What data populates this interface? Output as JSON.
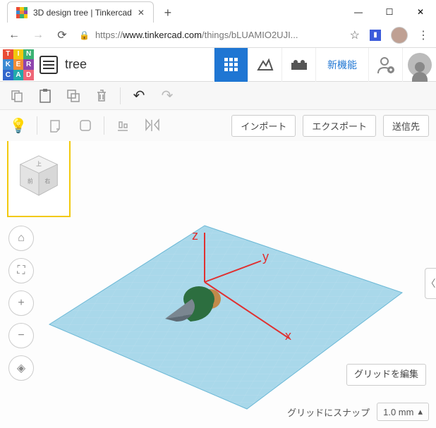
{
  "browser": {
    "tab_title": "3D design tree | Tinkercad",
    "url_prefix": "https://",
    "url_host": "www.tinkercad.com",
    "url_path": "/things/bLUAMIO2UJI...",
    "favicon_colors": [
      "#e94b35",
      "#f2c90d",
      "#3bb273",
      "#3b8bd3",
      "#f28c35",
      "#8e44ad",
      "#e94b35",
      "#3bb273",
      "#f2c90d"
    ]
  },
  "header": {
    "logo_letters": [
      "T",
      "I",
      "N",
      "K",
      "E",
      "R",
      "C",
      "A",
      "D"
    ],
    "logo_colors": [
      "#e94b35",
      "#f2c90d",
      "#3bb273",
      "#3b8bd3",
      "#f28c35",
      "#8e44ad",
      "#36c",
      "#2aa",
      "#e67"
    ],
    "doc_name": "tree",
    "new_feature": "新機能"
  },
  "toolbar2": {
    "import": "インポート",
    "export": "エクスポート",
    "send_to": "送信先"
  },
  "viewcube": {
    "top": "上",
    "front": "前",
    "right": "右"
  },
  "nav": {
    "home": "⌂",
    "fit": "⛶",
    "zoom_in": "+",
    "zoom_out": "−",
    "ortho": "◈"
  },
  "axes": {
    "x": "x",
    "y": "y",
    "z": "z"
  },
  "bottom": {
    "edit_grid": "グリッドを編集",
    "snap_label": "グリッドにスナップ",
    "snap_value": "1.0 mm"
  }
}
